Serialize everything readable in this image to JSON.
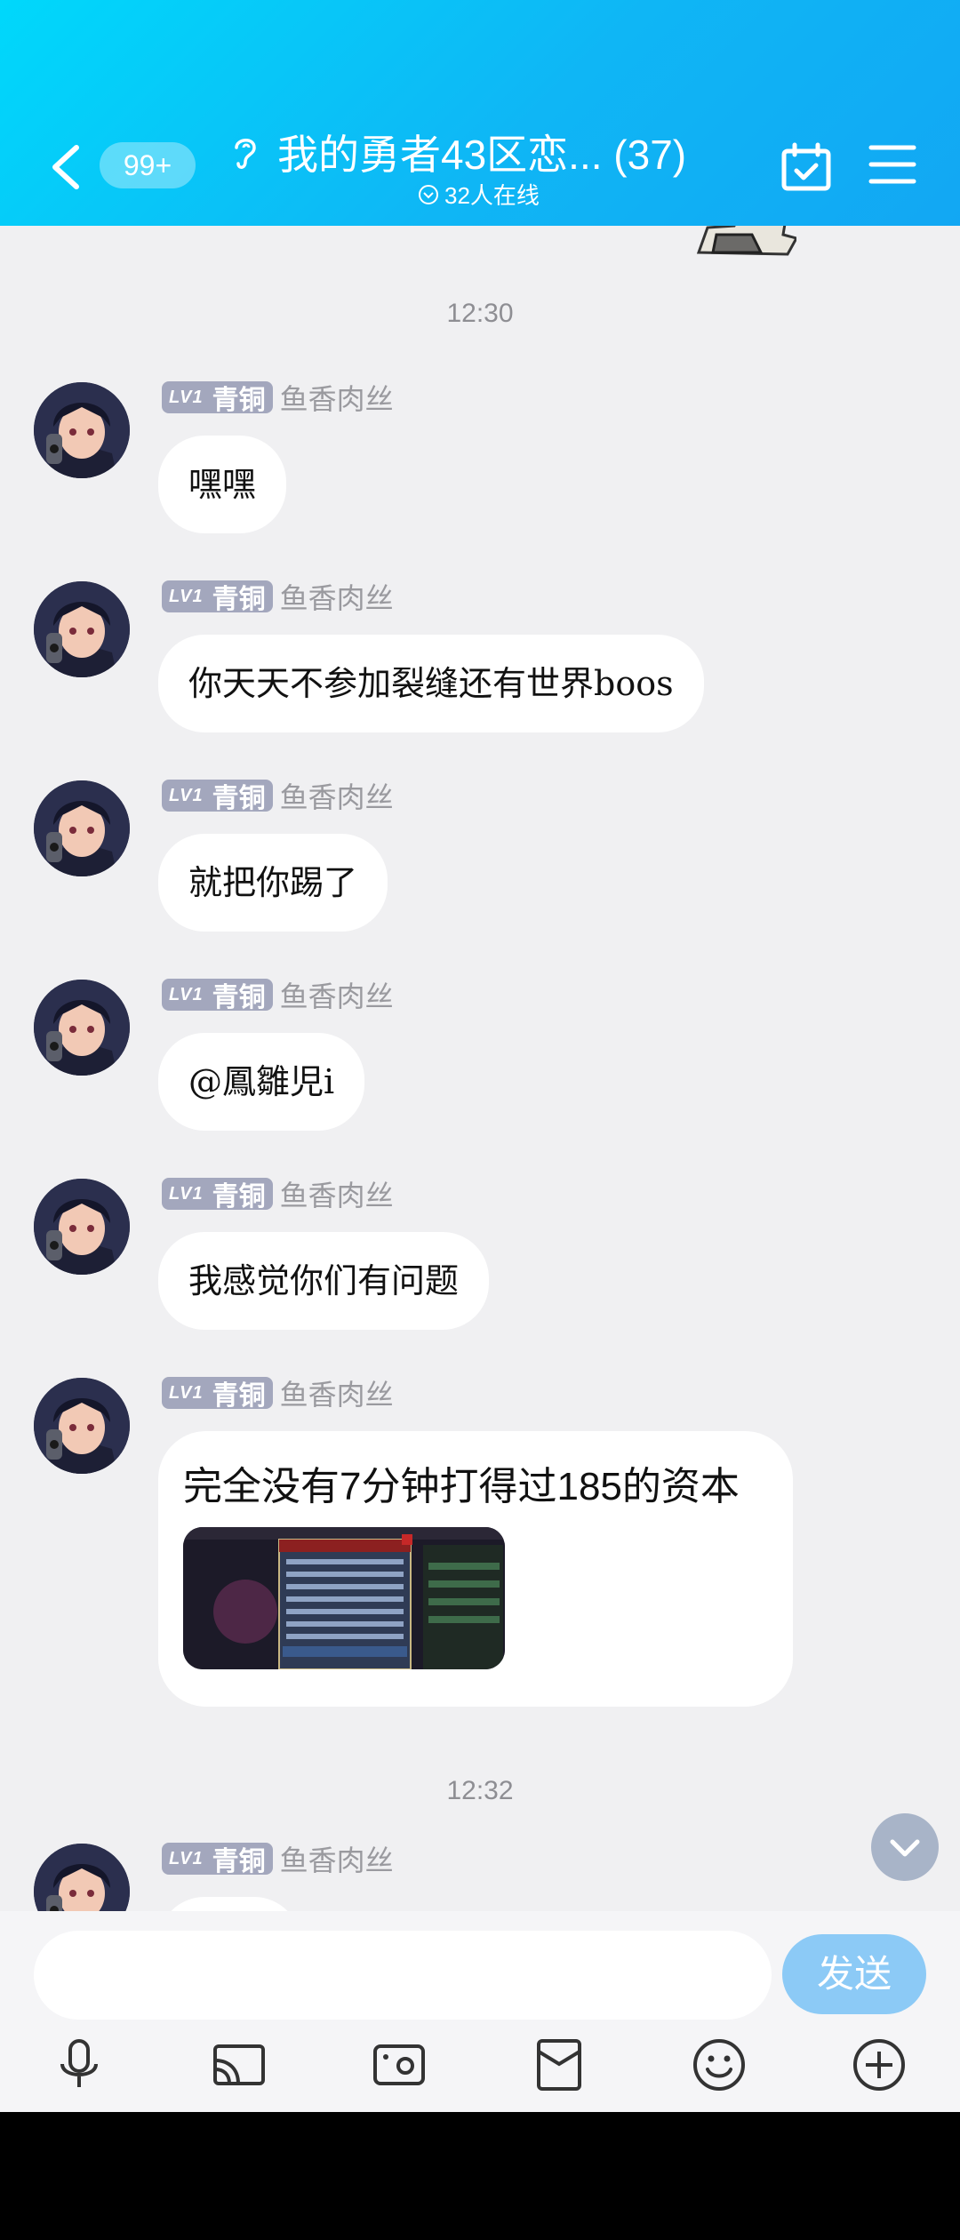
{
  "header": {
    "back_label": "<",
    "unread_badge": "99+",
    "title": "我的勇者43区恋... (37)",
    "online_status": "32人在线"
  },
  "timestamps": [
    "12:30",
    "12:32"
  ],
  "messages": [
    {
      "level": "LV1",
      "rank": "青铜",
      "sender": "鱼香肉丝",
      "text": "嘿嘿"
    },
    {
      "level": "LV1",
      "rank": "青铜",
      "sender": "鱼香肉丝",
      "text": "你天天不参加裂缝还有世界boos"
    },
    {
      "level": "LV1",
      "rank": "青铜",
      "sender": "鱼香肉丝",
      "text": "就把你踢了"
    },
    {
      "level": "LV1",
      "rank": "青铜",
      "sender": "鱼香肉丝",
      "text": "@鳳雛児i"
    },
    {
      "level": "LV1",
      "rank": "青铜",
      "sender": "鱼香肉丝",
      "text": "我感觉你们有问题"
    },
    {
      "level": "LV1",
      "rank": "青铜",
      "sender": "鱼香肉丝",
      "text": "完全没有7分钟打得过185的资本"
    },
    {
      "level": "LV1",
      "rank": "青铜",
      "sender": "鱼香肉丝",
      "text": ""
    }
  ],
  "input": {
    "placeholder": "",
    "send_label": "发送"
  },
  "toolbar": [
    "microphone-icon",
    "screen-share-icon",
    "photo-icon",
    "red-packet-icon",
    "emoji-icon",
    "plus-icon"
  ],
  "colors": {
    "header_start": "#00d8fb",
    "header_end": "#12a7f3",
    "send_button": "#8ccaf6",
    "level_tag": "#a3a7bd"
  }
}
